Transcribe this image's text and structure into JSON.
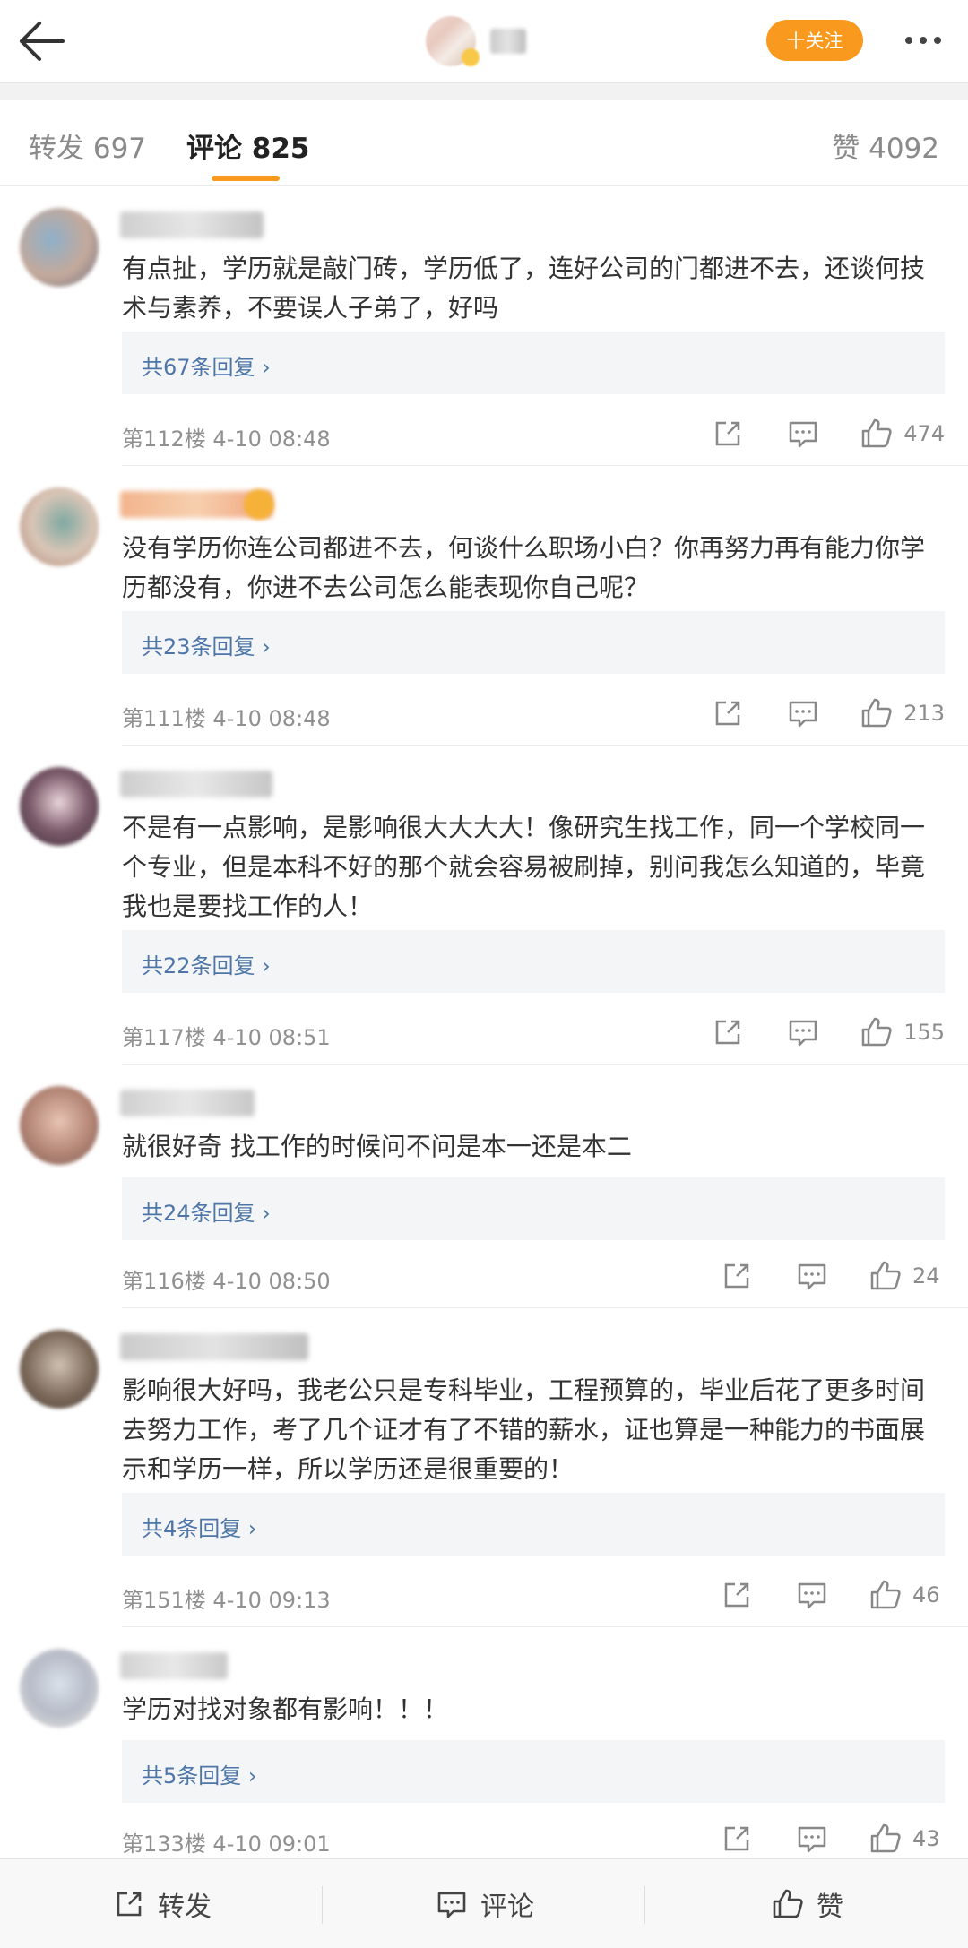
{
  "header": {
    "follow_label": "十关注",
    "back_icon": "arrow-left-icon",
    "more_icon": "more-dots-icon"
  },
  "tabs": [
    {
      "label": "转发 697",
      "active": false
    },
    {
      "label": "评论 825",
      "active": true
    },
    {
      "label": "赞 4092",
      "active": false
    }
  ],
  "colors": {
    "accent": "#f99a1e",
    "link": "#4d75a8",
    "meta": "#909090"
  },
  "comments": [
    {
      "text": "有点扯，学历就是敲门砖，学历低了，连好公司的门都进不去，还谈何技术与素养，不要误人子弟了，好吗",
      "reply_label": "共67条回复 ›",
      "meta": "第112楼  4-10 08:48",
      "likes": "474"
    },
    {
      "text": "没有学历你连公司都进不去，何谈什么职场小白？你再努力再有能力你学历都没有，你进不去公司怎么能表现你自己呢？",
      "reply_label": "共23条回复 ›",
      "meta": "第111楼  4-10 08:48",
      "likes": "213"
    },
    {
      "text": "不是有一点影响，是影响很大大大大！像研究生找工作，同一个学校同一个专业，但是本科不好的那个就会容易被刷掉，别问我怎么知道的，毕竟我也是要找工作的人！",
      "reply_label": "共22条回复 ›",
      "meta": "第117楼  4-10 08:51",
      "likes": "155"
    },
    {
      "text": "就很好奇 找工作的时候问不问是本一还是本二",
      "reply_label": "共24条回复 ›",
      "meta": "第116楼  4-10 08:50",
      "likes": "24"
    },
    {
      "text": "影响很大好吗，我老公只是专科毕业，工程预算的，毕业后花了更多时间去努力工作，考了几个证才有了不错的薪水，证也算是一种能力的书面展示和学历一样，所以学历还是很重要的！",
      "reply_label": "共4条回复 ›",
      "meta": "第151楼  4-10 09:13",
      "likes": "46"
    },
    {
      "text": "学历对找对象都有影响！！！",
      "reply_label": "共5条回复 ›",
      "meta": "第133楼  4-10 09:01",
      "likes": "43"
    }
  ],
  "bottom_bar": {
    "repost_label": "转发",
    "comment_label": "评论",
    "like_label": "赞"
  }
}
